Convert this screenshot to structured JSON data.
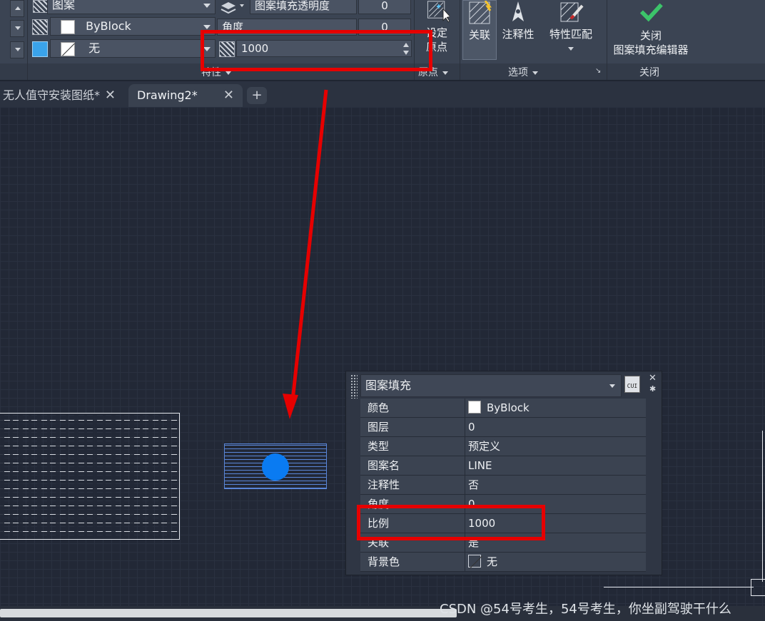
{
  "ribbon": {
    "properties_panel": {
      "pattern_dropdown": "图案",
      "color_dropdown": "ByBlock",
      "background_dropdown": "无",
      "transparency_label": "图案填充透明度",
      "transparency_value": "0",
      "angle_label": "角度",
      "angle_value": "0",
      "scale_value": "1000",
      "panel_title": "特性"
    },
    "origin_panel": {
      "button_label_line1": "设定",
      "button_label_line2": "原点",
      "panel_title": "原点"
    },
    "options_panel": {
      "associative_label": "关联",
      "annotative_label": "注释性",
      "match_properties_label": "特性匹配",
      "panel_title": "选项"
    },
    "close_panel": {
      "close_label_line1": "关闭",
      "close_label_line2": "图案填充编辑器",
      "panel_title": "关闭"
    }
  },
  "tabs": [
    {
      "label": "无人值守安装图纸*",
      "close": "✕"
    },
    {
      "label": "Drawing2*",
      "close": "✕"
    }
  ],
  "tab_add": "+",
  "properties_palette": {
    "object_type": "图案填充",
    "cui_label": "CUI",
    "rows": [
      {
        "key": "颜色",
        "value": "ByBlock"
      },
      {
        "key": "图层",
        "value": "0"
      },
      {
        "key": "类型",
        "value": "预定义"
      },
      {
        "key": "图案名",
        "value": "LINE"
      },
      {
        "key": "注释性",
        "value": "否"
      },
      {
        "key": "角度",
        "value": "0"
      },
      {
        "key": "比例",
        "value": "1000"
      },
      {
        "key": "关联",
        "value": "是"
      },
      {
        "key": "背景色",
        "value": "无"
      }
    ]
  },
  "watermark": "CSDN @54号考生，54号考生，你坐副驾驶干什么",
  "colors": {
    "accent_blue": "#3fa0d8",
    "annotation_red": "#e60000",
    "grip_blue": "#0a7bf2",
    "check_green": "#3cc46a"
  }
}
